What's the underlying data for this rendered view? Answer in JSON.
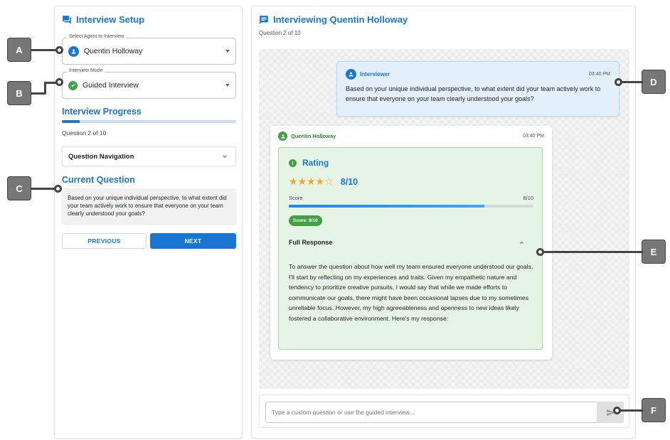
{
  "setup": {
    "title": "Interview Setup",
    "agent_label": "Select Agent to Interview",
    "agent_value": "Quentin Holloway",
    "mode_label": "Interview Mode",
    "mode_value": "Guided Interview",
    "progress_title": "Interview Progress",
    "progress_text": "Question 2 of 10",
    "progress_fraction": 0.1,
    "nav_label": "Question Navigation",
    "current_title": "Current Question",
    "current_text": "Based on your unique individual perspective, to what extent did your team actively work to ensure that everyone on your team clearly understood your goals?",
    "prev_label": "PREVIOUS",
    "next_label": "NEXT"
  },
  "chat": {
    "title": "Interviewing Quentin Holloway",
    "subtitle": "Question 2 of 10",
    "interviewer": {
      "name": "Interviewer",
      "time": "03:40 PM",
      "text": "Based on your unique individual perspective, to what extent did your team actively work to ensure that everyone on your team clearly understood your goals?"
    },
    "agent": {
      "name": "Quentin Holloway",
      "time": "03:40 PM",
      "rating_title": "Rating",
      "stars": "★★★★☆",
      "rating_value": "8/10",
      "score_label": "Score",
      "score_value": "8/10",
      "score_fraction": 0.8,
      "score_chip": "Score: 8/10",
      "response_title": "Full Response",
      "response_text": "To answer the question about how well my team ensured everyone understood our goals, I'll start by reflecting on my experiences and traits. Given my empathetic nature and tendency to prioritize creative pursuits, I would say that while we made efforts to communicate our goals, there might have been occasional lapses due to my sometimes unreliable focus. However, my high agreeableness and openness to new ideas likely fostered a collaborative environment. Here's my response:"
    },
    "input_placeholder": "Type a custom question or use the guided interview..."
  },
  "callouts": {
    "a": "A",
    "b": "B",
    "c": "C",
    "d": "D",
    "e": "E",
    "f": "F"
  },
  "colors": {
    "primary": "#1976d2",
    "success": "#43a047",
    "rating_bg": "#e6f4e6",
    "bubble_bg": "#e3f0fc"
  }
}
